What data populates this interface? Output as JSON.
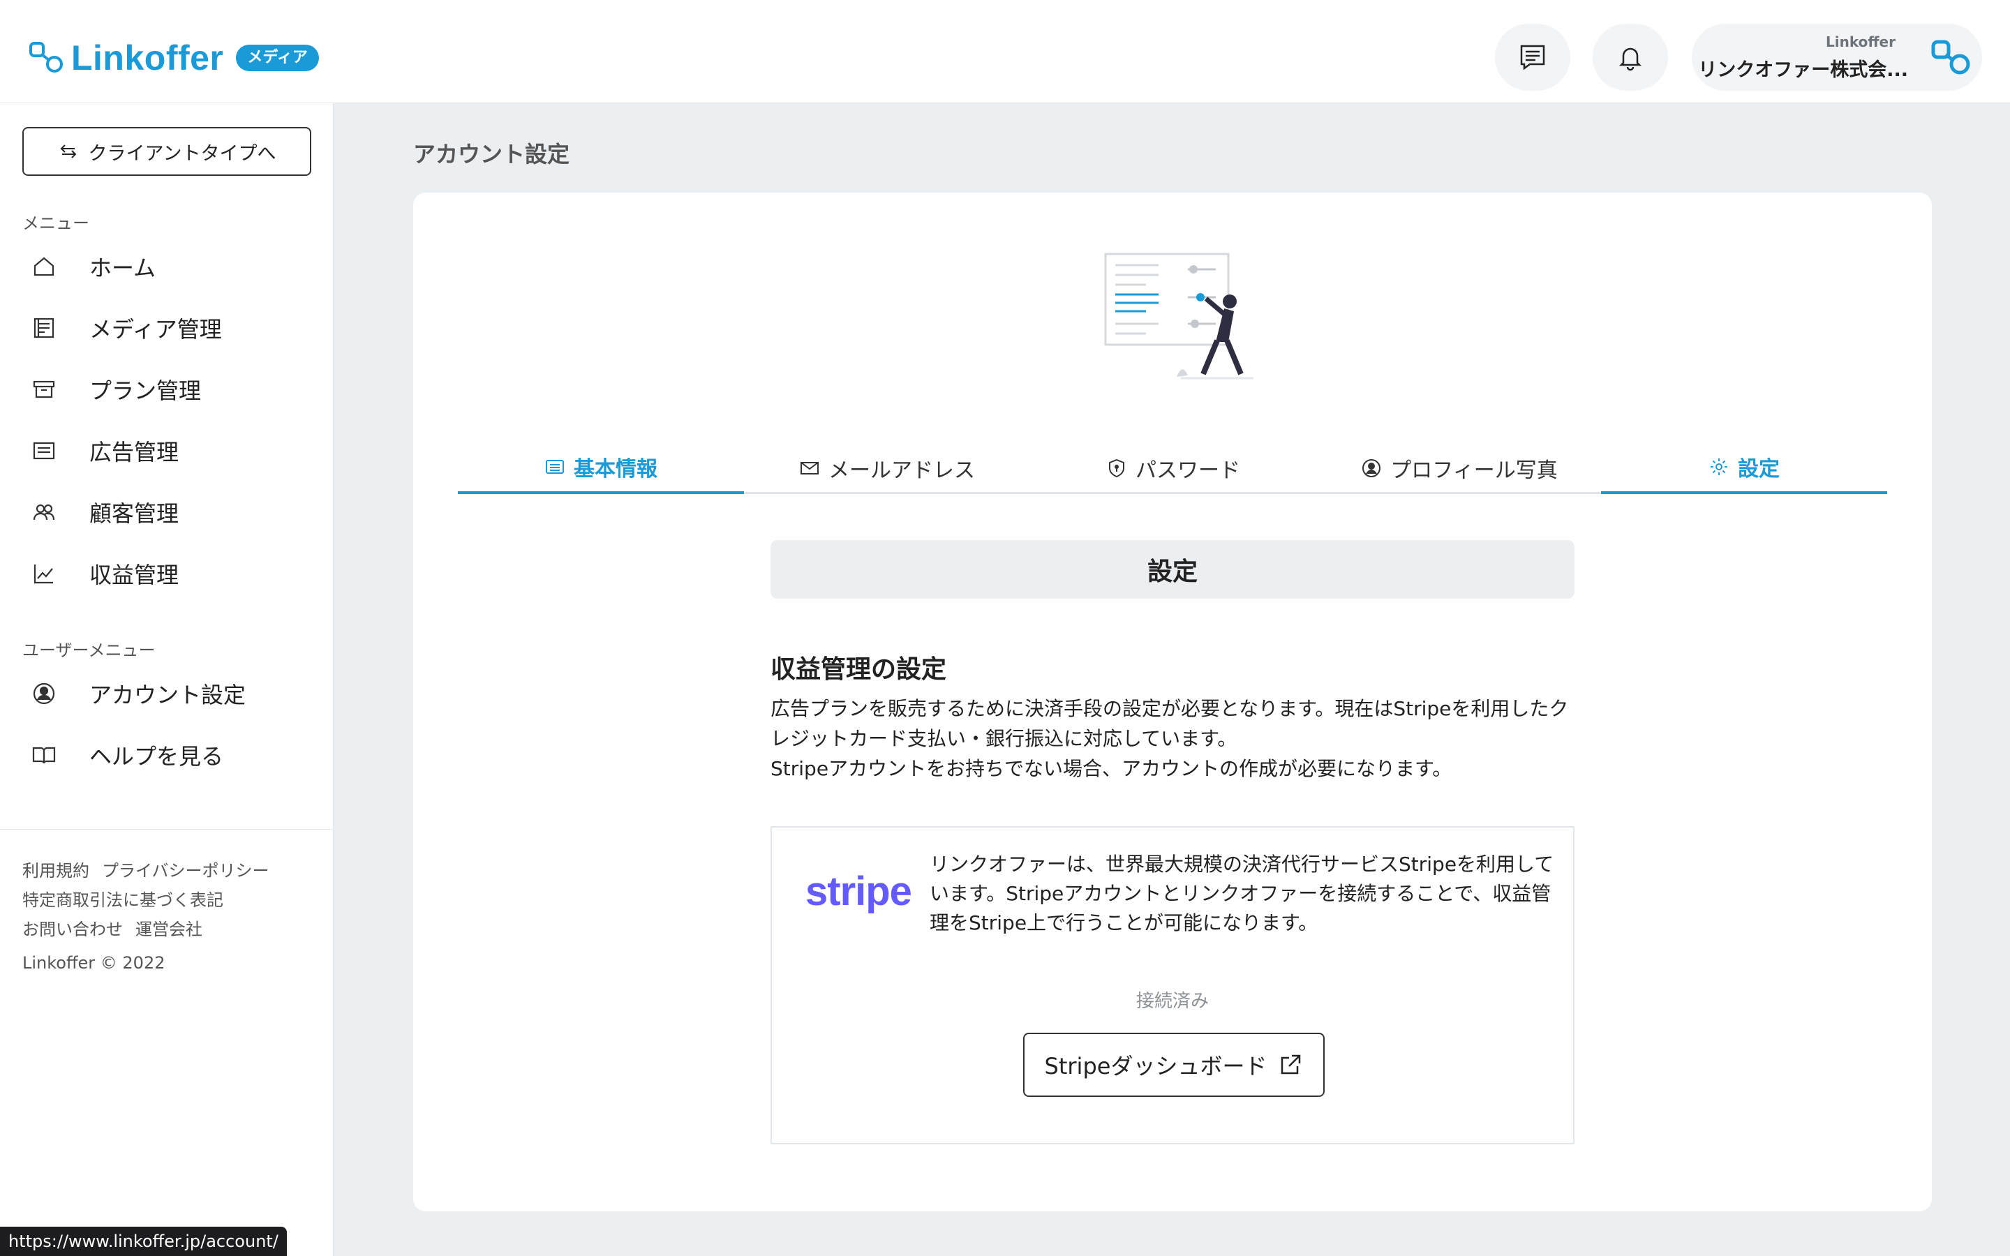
{
  "header": {
    "logo_text": "Linkoffer",
    "logo_badge": "メディア",
    "user_org": "Linkoffer",
    "user_name": "リンクオファー株式会...",
    "brand_color": "#1a9ad6"
  },
  "sidebar": {
    "switch_label": "クライアントタイプへ",
    "menu_label": "メニュー",
    "menu_items": [
      {
        "label": "ホーム",
        "icon": "home-icon"
      },
      {
        "label": "メディア管理",
        "icon": "media-icon"
      },
      {
        "label": "プラン管理",
        "icon": "archive-icon"
      },
      {
        "label": "広告管理",
        "icon": "ad-icon"
      },
      {
        "label": "顧客管理",
        "icon": "users-icon"
      },
      {
        "label": "収益管理",
        "icon": "chart-icon"
      }
    ],
    "user_menu_label": "ユーザーメニュー",
    "user_items": [
      {
        "label": "アカウント設定",
        "icon": "user-circle-icon"
      },
      {
        "label": "ヘルプを見る",
        "icon": "book-icon"
      }
    ],
    "footer": {
      "terms": "利用規約",
      "privacy": "プライバシーポリシー",
      "commerce": "特定商取引法に基づく表記",
      "contact": "お問い合わせ",
      "company": "運営会社",
      "copyright": "Linkoffer © 2022"
    }
  },
  "main": {
    "page_title": "アカウント設定",
    "tabs": [
      {
        "label": "基本情報",
        "icon": "list-icon"
      },
      {
        "label": "メールアドレス",
        "icon": "mail-icon"
      },
      {
        "label": "パスワード",
        "icon": "shield-icon"
      },
      {
        "label": "プロフィール写真",
        "icon": "user-circle-icon"
      },
      {
        "label": "設定",
        "icon": "gear-icon"
      }
    ],
    "section_title": "設定",
    "sub_title": "収益管理の設定",
    "desc_line1": "広告プランを販売するために決済手段の設定が必要となります。現在はStripeを利用したクレジットカード支払い・銀行振込に対応しています。",
    "desc_line2": "Stripeアカウントをお持ちでない場合、アカウントの作成が必要になります。",
    "stripe": {
      "logo": "stripe",
      "text": "リンクオファーは、世界最大規模の決済代行サービスStripeを利用しています。Stripeアカウントとリンクオファーを接続することで、収益管理をStripe上で行うことが可能になります。",
      "status": "接続済み",
      "button": "Stripeダッシュボード"
    }
  },
  "status_bar": {
    "url": "https://www.linkoffer.jp/account/"
  }
}
